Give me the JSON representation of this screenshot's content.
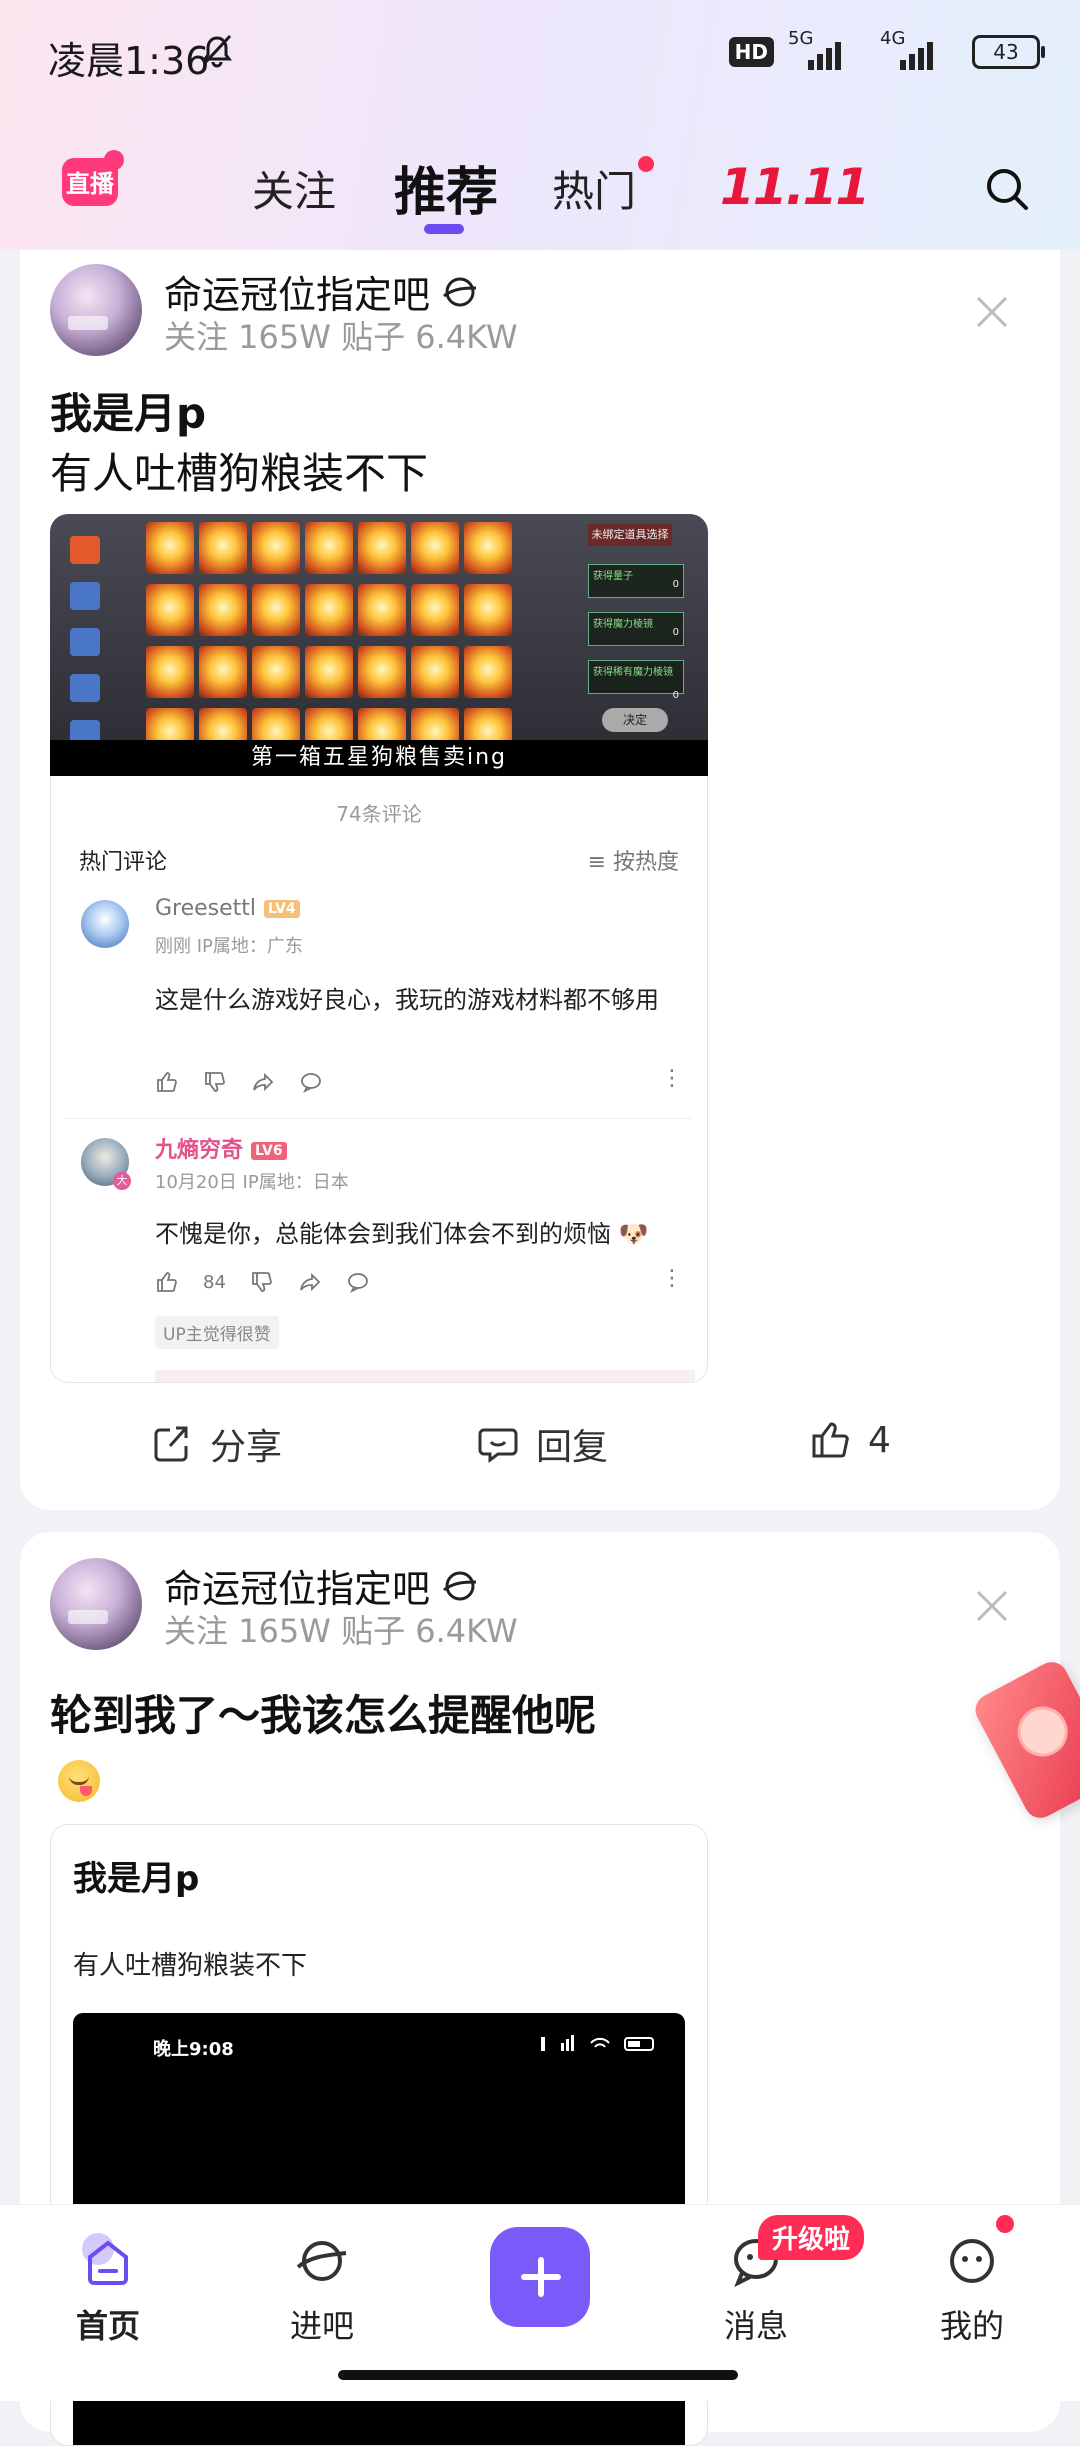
{
  "status_bar": {
    "time": "凌晨1:36",
    "hd": "HD",
    "net1": "5G",
    "net2": "4G",
    "battery": "43"
  },
  "top_nav": {
    "live_label": "直播",
    "tabs": [
      {
        "label": "关注"
      },
      {
        "label": "推荐"
      },
      {
        "label": "热门"
      },
      {
        "label": "11.11"
      }
    ]
  },
  "posts": [
    {
      "forum": "命运冠位指定吧",
      "meta": "关注 165W   贴子 6.4KW",
      "title": "我是月p",
      "body": "有人吐槽狗粮装不下",
      "image_caption": "第一箱五星狗粮售卖ing",
      "game_panel": {
        "header": "未绑定道具选择",
        "rows": [
          "获得量子",
          "获得魔力棱镜",
          "获得稀有魔力棱镜"
        ],
        "zero": "0",
        "button": "决定"
      },
      "comments_block": {
        "count": "74条评论",
        "hot_label": "热门评论",
        "sort_label": "≡ 按热度",
        "comments": [
          {
            "user": "Greesettl",
            "level": "LV4",
            "meta": "刚刚  IP属地：广东",
            "text": "这是什么游戏好良心，我玩的游戏材料都不够用",
            "likes": ""
          },
          {
            "user": "九熵穷奇",
            "level": "LV6",
            "meta": "10月20日  IP属地：日本",
            "text": "不愧是你，总能体会到我们体会不到的烦恼 🐶",
            "likes": "84",
            "badge": "UP主觉得很赞"
          }
        ]
      },
      "actions": {
        "share": "分享",
        "reply": "回复",
        "like": "4"
      }
    },
    {
      "forum": "命运冠位指定吧",
      "meta": "关注 165W   贴子 6.4KW",
      "title": "轮到我了～我该怎么提醒他呢",
      "nested": {
        "title": "我是月p",
        "body": "有人吐槽狗粮装不下",
        "time": "晚上9:08"
      }
    }
  ],
  "bottom_nav": {
    "items": [
      {
        "label": "首页"
      },
      {
        "label": "进吧"
      },
      {
        "label": "消息"
      },
      {
        "label": "我的"
      }
    ],
    "upgrade_badge": "升级啦"
  },
  "colors": {
    "accent": "#7a5af8",
    "tab_indicator": "#6b4cf0",
    "notify_red": "#ff2d55",
    "event_red": "#e8163a"
  }
}
